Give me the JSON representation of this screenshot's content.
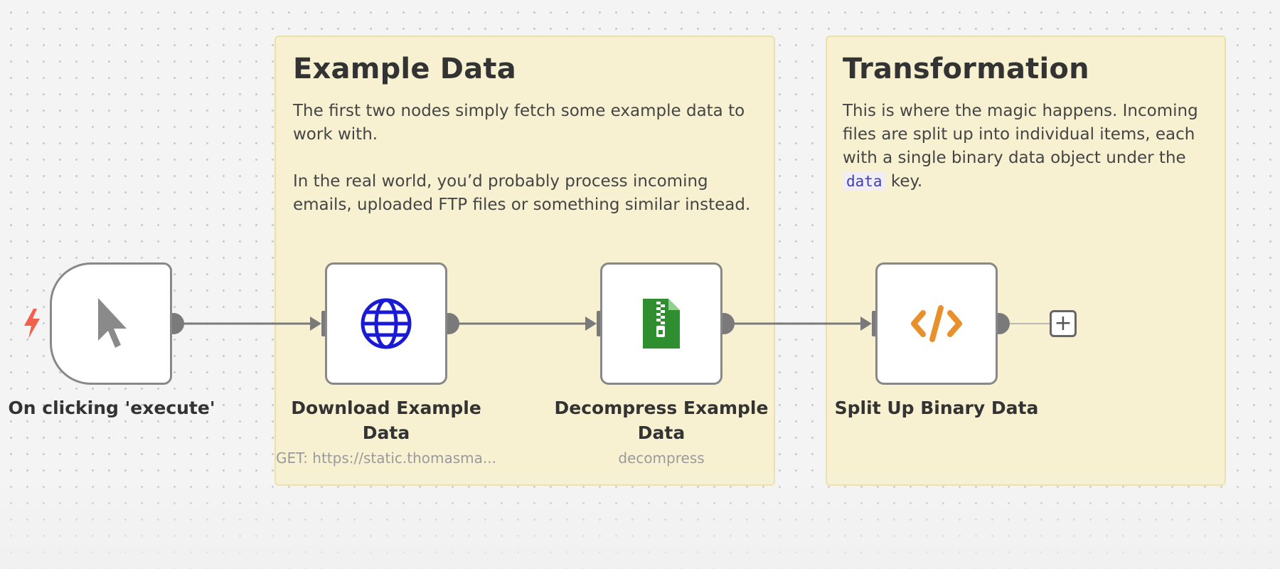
{
  "sticky_notes": [
    {
      "title": "Example Data",
      "lines": [
        "The first two nodes simply fetch some example data to",
        "work with.",
        "",
        "In the real world, you’d probably process incoming",
        "emails, uploaded FTP files or something similar instead."
      ]
    },
    {
      "title": "Transformation",
      "lines": [
        "This is where the magic happens. Incoming",
        "files are split up into individual items, each",
        "with a single binary data object under the"
      ],
      "code_word": "data",
      "after_code": " key."
    }
  ],
  "nodes": [
    {
      "label": "On clicking 'execute'",
      "subtitle": "",
      "icon": "cursor-icon"
    },
    {
      "label_line1": "Download Example",
      "label_line2": "Data",
      "subtitle": "GET: https://static.thomasma...",
      "icon": "globe-icon"
    },
    {
      "label_line1": "Decompress Example",
      "label_line2": "Data",
      "subtitle": "decompress",
      "icon": "zip-file-icon"
    },
    {
      "label": "Split Up Binary Data",
      "subtitle": "",
      "icon": "code-icon"
    }
  ],
  "add_button": "+",
  "colors": {
    "canvas": "#f4f4f4",
    "sticky_bg": "#f7f1d1",
    "sticky_border": "#ecdfa8",
    "connection": "#7a7a7a",
    "globe": "#1a1ad6",
    "zip": "#2f8f2f",
    "code": "#e8912c",
    "trigger_bolt": "#f0624d"
  }
}
